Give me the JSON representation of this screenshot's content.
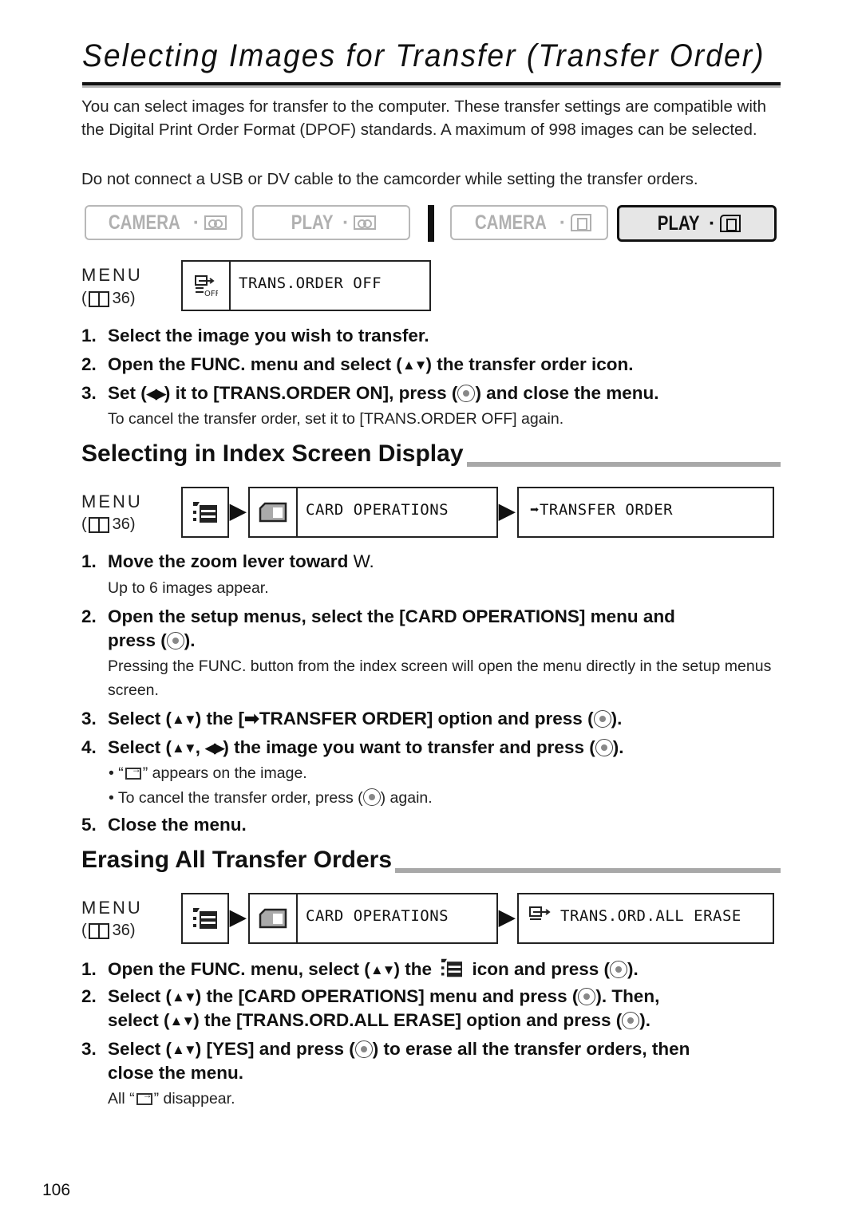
{
  "title": "Selecting Images for Transfer (Transfer Order)",
  "intro": {
    "p1": "You can select images for transfer to the computer. These transfer settings are compatible with the Digital Print Order Format (DPOF) standards. A maximum of 998 images can be selected.",
    "p2": "Do not connect a USB or DV cable to the camcorder while setting the transfer orders."
  },
  "modes": [
    {
      "label": "CAMERA",
      "icon": "tape-icon",
      "active": false
    },
    {
      "label": "PLAY",
      "icon": "tape-icon",
      "active": false
    },
    {
      "label": "CAMERA",
      "icon": "card-icon",
      "active": false
    },
    {
      "label": "PLAY",
      "icon": "card-icon",
      "active": true
    }
  ],
  "menu_label": "MENU",
  "menu_ref": "36)",
  "menu_ref_open": "(",
  "lcd1": {
    "icon": "transfer-order-off-icon",
    "text": "TRANS.ORDER OFF"
  },
  "steps_main": [
    {
      "num": "1.",
      "text": "Select the image you wish to transfer."
    },
    {
      "num": "2.",
      "a": "Open the FUNC. menu and select (",
      "b": ") the transfer order icon."
    },
    {
      "num": "3.",
      "a": "Set (",
      "b": ") it to [TRANS.ORDER ON], press (",
      "c": ") and close the menu."
    }
  ],
  "note_main": "To cancel the transfer order, set it to [TRANS.ORDER OFF] again.",
  "section2": {
    "heading": "Selecting in Index Screen Display",
    "lcd_mid": "CARD OPERATIONS",
    "lcd_end": "TRANSFER ORDER",
    "steps": [
      {
        "num": "1.",
        "a": "Move the zoom lever toward ",
        "b": "W."
      },
      {
        "num": "2.",
        "a": "Open the setup menus, select the [CARD OPERATIONS] menu and",
        "b": "press (",
        "c": ")."
      },
      {
        "num": "3.",
        "a": "Select (",
        "b": ") the [",
        "c": "TRANSFER ORDER] option and press (",
        "d": ")."
      },
      {
        "num": "4.",
        "a": "Select (",
        "b": ", ",
        "c": ") the image you want to transfer and press (",
        "d": ")."
      },
      {
        "num": "5.",
        "text": "Close the menu."
      }
    ],
    "note1": "Up to 6 images appear.",
    "note2": "Pressing the FUNC. button from the index screen will open the menu directly in the setup menus screen.",
    "bullet1_a": "• “",
    "bullet1_b": "” appears on the image.",
    "bullet2_a": "• To cancel the transfer order, press (",
    "bullet2_b": ") again."
  },
  "section3": {
    "heading": "Erasing All Transfer Orders",
    "lcd_mid": "CARD OPERATIONS",
    "lcd_end": "TRANS.ORD.ALL ERASE",
    "steps": [
      {
        "num": "1.",
        "a": "Open the FUNC. menu, select (",
        "b": ") the ",
        "c": " icon and press (",
        "d": ")."
      },
      {
        "num": "2.",
        "a": "Select (",
        "b": ") the [CARD OPERATIONS] menu and press (",
        "c": "). Then,",
        "d": "select (",
        "e": ") the [TRANS.ORD.ALL ERASE] option and press (",
        "f": ")."
      },
      {
        "num": "3.",
        "a": "Select (",
        "b": ") [YES] and press (",
        "c": ") to erase all the transfer orders, then",
        "d": "close the menu."
      }
    ],
    "note_a": "All “",
    "note_b": "” disappear."
  },
  "symbols": {
    "updown": "▲▼",
    "leftright": "◀▶"
  },
  "page_number": "106"
}
